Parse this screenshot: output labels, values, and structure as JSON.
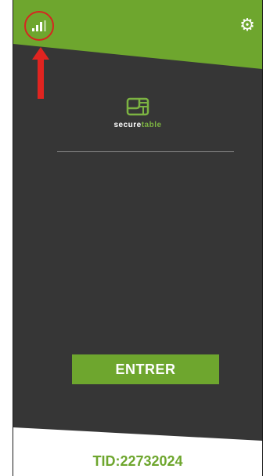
{
  "header": {
    "signal_icon": "signal-bars-icon",
    "settings_icon": "gear-icon",
    "settings_glyph": "⚙"
  },
  "annotation": {
    "arrow_icon": "red-arrow-up-icon",
    "highlight_color": "#d62620"
  },
  "logo": {
    "text_part1": "secure",
    "text_part2": "table",
    "icon": "securetable-logo-icon"
  },
  "main": {
    "enter_label": "ENTRER"
  },
  "footer": {
    "tid": "TID:22732024"
  },
  "colors": {
    "brand_green": "#6ea62e",
    "dark_background": "#363636",
    "logo_accent": "#7cb342"
  }
}
